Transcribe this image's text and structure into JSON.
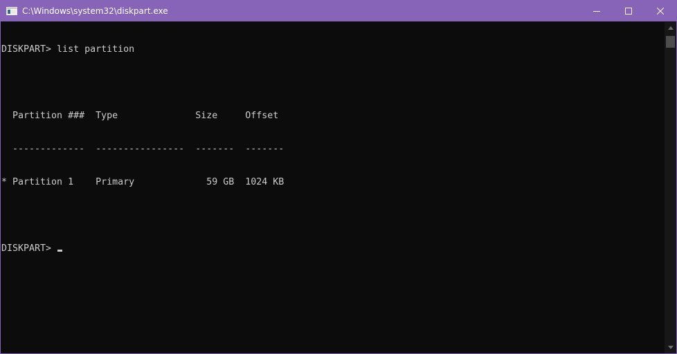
{
  "window": {
    "title": "C:\\Windows\\system32\\diskpart.exe",
    "accent_color": "#8764b8",
    "console_bg": "#0c0c0c",
    "console_fg": "#cccccc",
    "icons": {
      "app": "console-app-icon",
      "minimize": "minimize-icon",
      "maximize": "maximize-icon",
      "close": "close-icon"
    }
  },
  "console": {
    "lines": [
      "DISKPART> list partition",
      "",
      "  Partition ###  Type              Size     Offset",
      "  -------------  ----------------  -------  -------",
      "* Partition 1    Primary             59 GB  1024 KB",
      "",
      "DISKPART> "
    ]
  }
}
